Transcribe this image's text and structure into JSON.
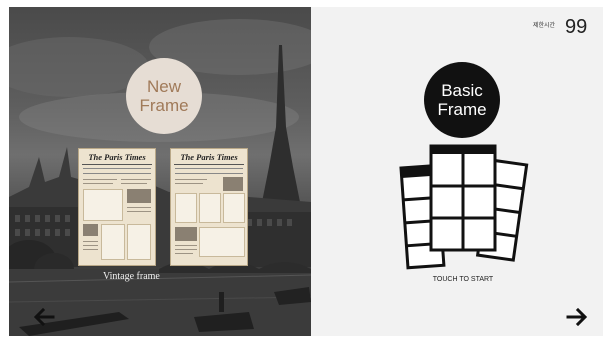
{
  "new_frame": {
    "line1": "New",
    "line2": "Frame"
  },
  "papers": [
    {
      "masthead": "The Paris Times"
    },
    {
      "masthead": "The Paris Times"
    }
  ],
  "vintage_label": "Vintage frame",
  "basic_frame": {
    "line1": "Basic",
    "line2": "Frame"
  },
  "timer": {
    "label": "제한시간",
    "value": "99"
  },
  "touch_to_start": "TOUCH TO START",
  "icons": {
    "back": "arrow-left-icon",
    "next": "arrow-right-icon"
  },
  "colors": {
    "left_panel": "#555555",
    "new_frame_circle": "#e6ddd4",
    "new_frame_text": "#a07a59",
    "basic_circle": "#111111",
    "right_panel": "#f2f2f2"
  }
}
